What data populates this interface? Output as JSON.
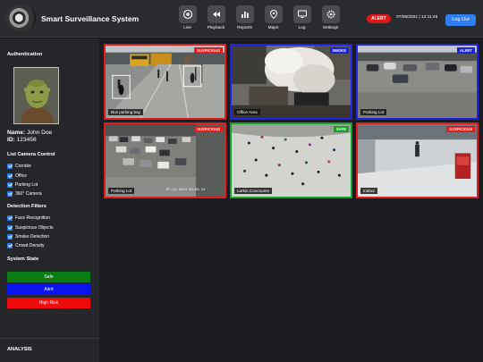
{
  "header": {
    "title": "Smart Surveillance System",
    "nav": [
      {
        "label": "Live",
        "icon": "live-icon"
      },
      {
        "label": "Playback",
        "icon": "rewind-icon"
      },
      {
        "label": "Reports",
        "icon": "bar-chart-icon"
      },
      {
        "label": "Maps",
        "icon": "map-pin-icon"
      },
      {
        "label": "Log",
        "icon": "monitor-icon"
      },
      {
        "label": "Settings",
        "icon": "gear-icon"
      }
    ],
    "alert_badge": "ALERT",
    "datetime": "07/06/2021 | 12:11:46",
    "logout_label": "Log Out"
  },
  "sidebar": {
    "auth_title": "Authentication",
    "user": {
      "name_label": "Name:",
      "name": "John Doe",
      "id_label": "ID:",
      "id": "123456"
    },
    "camera_control_title": "List Camera Control",
    "cameras": [
      "Corridor",
      "Office",
      "Parking Lot",
      "360° Camera"
    ],
    "detection_title": "Detection Filters",
    "filters": [
      "Face Recognition",
      "Suspicious Objects",
      "Smoke Detection",
      "Crowd Density"
    ],
    "state_title": "System State",
    "states": [
      {
        "label": "Safe",
        "color": "#0a7d12"
      },
      {
        "label": "Alert",
        "color": "#0a14ef"
      },
      {
        "label": "High Risk",
        "color": "#ef0b0b"
      }
    ],
    "analysis_title": "ANALYSIS"
  },
  "feeds": [
    {
      "label": "Bus parking bay",
      "badge": "SUSPICIOUS",
      "status_color": "#e11d1d"
    },
    {
      "label": "Office Area",
      "badge": "SMOKE",
      "status_color": "#1e22e6"
    },
    {
      "label": "Parking Lot",
      "badge": "ALERT",
      "status_color": "#1e22e6"
    },
    {
      "label": "Parking Lot",
      "badge": "SUSPICIOUS",
      "status_color": "#e11d1d",
      "timestamp": "07-24-2014 03:05:24"
    },
    {
      "label": "Larkin Concourse",
      "badge": "SAFE",
      "status_color": "#15a32a"
    },
    {
      "label": "Indoor",
      "badge": "SUSPICIOUS",
      "status_color": "#e11d1d"
    }
  ],
  "colors": {
    "accent": "#2f7ef2",
    "alert": "#e01717"
  }
}
